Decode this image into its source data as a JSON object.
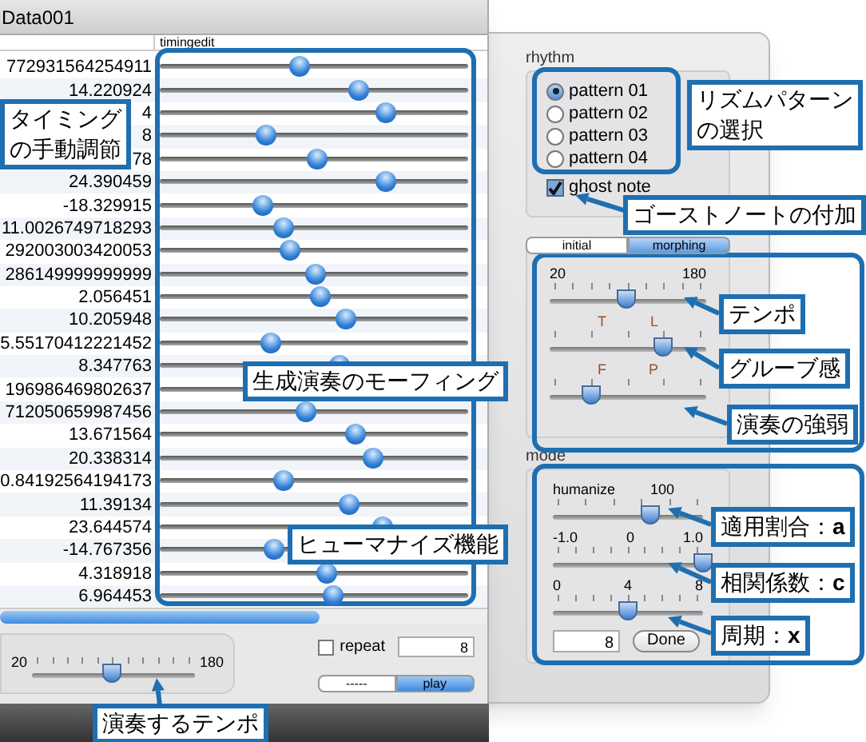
{
  "window": {
    "title": "Data001"
  },
  "table": {
    "columns": [
      "timingedit"
    ],
    "rows": [
      {
        "value": "772931564254911",
        "level": 0.45
      },
      {
        "value": "14.220924",
        "level": 0.64
      },
      {
        "value": "4",
        "level": 0.73
      },
      {
        "value": "8",
        "level": 0.34
      },
      {
        "value": "78",
        "level": 0.51
      },
      {
        "value": "24.390459",
        "level": 0.73
      },
      {
        "value": "-18.329915",
        "level": 0.33
      },
      {
        "value": "11.0026749718293",
        "level": 0.4
      },
      {
        "value": "292003003420053",
        "level": 0.42
      },
      {
        "value": "286149999999999",
        "level": 0.5
      },
      {
        "value": "2.056451",
        "level": 0.52
      },
      {
        "value": "10.205948",
        "level": 0.6
      },
      {
        "value": "5.55170412221452",
        "level": 0.36
      },
      {
        "value": "8.347763",
        "level": 0.58
      },
      {
        "value": "196986469802637"
      },
      {
        "value": "712050659987456",
        "level": 0.47
      },
      {
        "value": "13.671564",
        "level": 0.63
      },
      {
        "value": "20.338314",
        "level": 0.69
      },
      {
        "value": "0.84192564194173",
        "level": 0.4
      },
      {
        "value": "11.39134",
        "level": 0.61
      },
      {
        "value": "23.644574",
        "level": 0.72
      },
      {
        "value": "-14.767356",
        "level": 0.37
      },
      {
        "value": "4.318918",
        "level": 0.54
      },
      {
        "value": "6.964453",
        "level": 0.56
      }
    ]
  },
  "tempo": {
    "min": "20",
    "max": "180",
    "level": 0.49
  },
  "repeat": {
    "label": "repeat",
    "checked": false,
    "value": "8"
  },
  "transport": [
    {
      "label": "-----",
      "selected": false
    },
    {
      "label": "play",
      "selected": true
    }
  ],
  "rhythm": {
    "title": "rhythm",
    "patterns": [
      {
        "label": "pattern 01",
        "selected": true
      },
      {
        "label": "pattern 02",
        "selected": false
      },
      {
        "label": "pattern 03",
        "selected": false
      },
      {
        "label": "pattern 04",
        "selected": false
      }
    ],
    "ghost_note": {
      "label": "ghost note",
      "checked": true
    }
  },
  "tabs": [
    {
      "label": "initial",
      "selected": false
    },
    {
      "label": "morphing",
      "selected": true
    }
  ],
  "morph_sliders": [
    {
      "kind": "ends",
      "labels": [
        "20",
        "180"
      ],
      "level": 0.49
    },
    {
      "kind": "inner",
      "labels": [
        "T",
        "L"
      ],
      "level": 0.72
    },
    {
      "kind": "inner",
      "labels": [
        "F",
        "P"
      ],
      "level": 0.27
    }
  ],
  "mode": {
    "title": "mode",
    "sliders": [
      {
        "kind": "humanize",
        "labels": [
          "humanize",
          "100"
        ],
        "level": 0.65
      },
      {
        "kind": "ends",
        "labels": [
          "-1.0",
          "0",
          "1.0"
        ],
        "level": 1.0
      },
      {
        "kind": "ends",
        "labels": [
          "0",
          "4",
          "8"
        ],
        "level": 0.5
      }
    ],
    "value": "8",
    "button": "Done"
  },
  "annotations": [
    {
      "text": "タイミングの手動調節"
    },
    {
      "text": "生成演奏のモーフィング"
    },
    {
      "text": "ヒューマナイズ機能"
    },
    {
      "text": "リズムパターンの選択"
    },
    {
      "text": "ゴーストノートの付加"
    },
    {
      "text": "テンポ"
    },
    {
      "text": "グルーブ感"
    },
    {
      "text": "演奏の強弱"
    },
    {
      "text": "適用割合：**a**"
    },
    {
      "text": "相関係数：**c**"
    },
    {
      "text": "周期：**x**"
    },
    {
      "text": "演奏するテンポ"
    }
  ]
}
